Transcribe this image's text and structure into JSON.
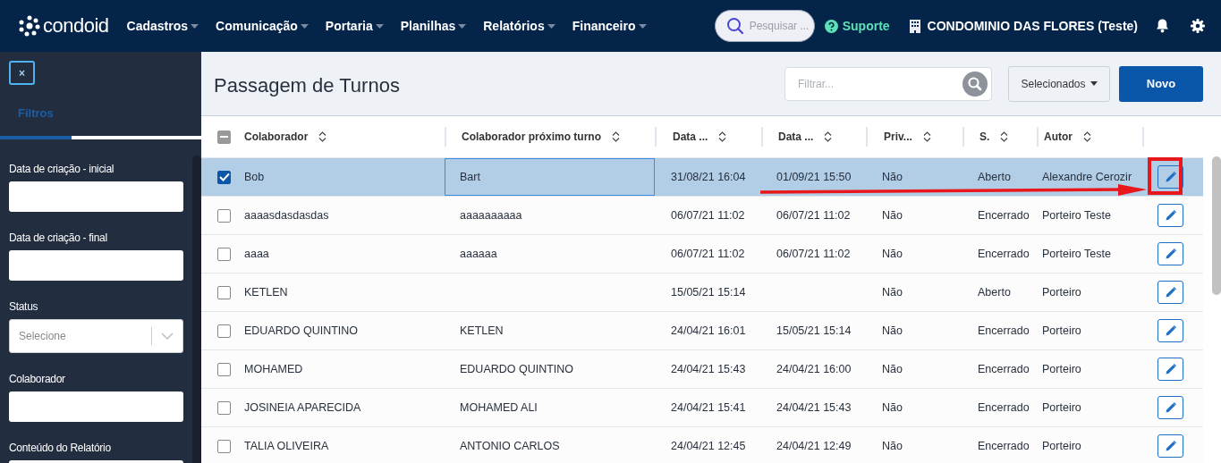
{
  "header": {
    "logo": "condoid",
    "nav": [
      {
        "label": "Cadastros"
      },
      {
        "label": "Comunicação"
      },
      {
        "label": "Portaria"
      },
      {
        "label": "Planilhas"
      },
      {
        "label": "Relatórios"
      },
      {
        "label": "Financeiro"
      }
    ],
    "search": {
      "placeholder": "Pesquisar ..."
    },
    "support": "Suporte",
    "condominium": "CONDOMINIO DAS FLORES (Teste)"
  },
  "sidebar": {
    "close": "×",
    "tabs": [
      {
        "label": "Filtros",
        "selected": true
      }
    ],
    "filters": [
      {
        "kind": "text",
        "label": "Data de criação - inicial"
      },
      {
        "kind": "text",
        "label": "Data de criação - final"
      },
      {
        "kind": "select",
        "label": "Status",
        "placeholder": "Selecione"
      },
      {
        "kind": "text",
        "label": "Colaborador"
      },
      {
        "kind": "text",
        "label": "Conteúdo do Relatório"
      }
    ]
  },
  "page": {
    "title": "Passagem de Turnos",
    "filter": {
      "placeholder": "Filtrar..."
    },
    "selected_menu": "Selecionados",
    "new_button": "Novo"
  },
  "table": {
    "header_checkbox": {
      "indeterminate": true
    },
    "columns": [
      "Colaborador",
      "Colaborador próximo turno",
      "Data ...",
      "Data ...",
      "Priv...",
      "S.",
      "Autor"
    ],
    "rows": [
      {
        "selected": true,
        "cell_focused": true,
        "annotated": true,
        "cells": [
          "Bob",
          "Bart",
          "31/08/21 16:04",
          "01/09/21 15:50",
          "Não",
          "Aberto",
          "Alexandre Cerozir"
        ]
      },
      {
        "selected": false,
        "cell_focused": false,
        "annotated": false,
        "cells": [
          "aaaasdasdasdas",
          "aaaaaaaaaa",
          "06/07/21 11:02",
          "06/07/21 11:02",
          "Não",
          "Encerrado",
          "Porteiro Teste"
        ]
      },
      {
        "selected": false,
        "cell_focused": false,
        "annotated": false,
        "cells": [
          "aaaa",
          "aaaaaa",
          "06/07/21 11:02",
          "06/07/21 11:02",
          "Não",
          "Encerrado",
          "Porteiro Teste"
        ]
      },
      {
        "selected": false,
        "cell_focused": false,
        "annotated": false,
        "cells": [
          "KETLEN",
          null,
          "15/05/21 15:14",
          null,
          "Não",
          "Aberto",
          "Porteiro"
        ]
      },
      {
        "selected": false,
        "cell_focused": false,
        "annotated": false,
        "cells": [
          "EDUARDO QUINTINO",
          "KETLEN",
          "24/04/21 16:01",
          "15/05/21 15:14",
          "Não",
          "Encerrado",
          "Porteiro"
        ]
      },
      {
        "selected": false,
        "cell_focused": false,
        "annotated": false,
        "cells": [
          "MOHAMED",
          "EDUARDO QUINTINO",
          "24/04/21 15:43",
          "24/04/21 16:00",
          "Não",
          "Encerrado",
          "Porteiro"
        ]
      },
      {
        "selected": false,
        "cell_focused": false,
        "annotated": false,
        "cells": [
          "JOSINEIA APARECIDA",
          "MOHAMED ALI",
          "24/04/21 15:41",
          "24/04/21 15:43",
          "Não",
          "Encerrado",
          "Porteiro"
        ]
      },
      {
        "selected": false,
        "cell_focused": false,
        "annotated": false,
        "cells": [
          "TALIA OLIVEIRA",
          "ANTONIO CARLOS",
          "24/04/21 12:45",
          "24/04/21 12:49",
          "Não",
          "Encerrado",
          "Porteiro"
        ]
      }
    ]
  }
}
